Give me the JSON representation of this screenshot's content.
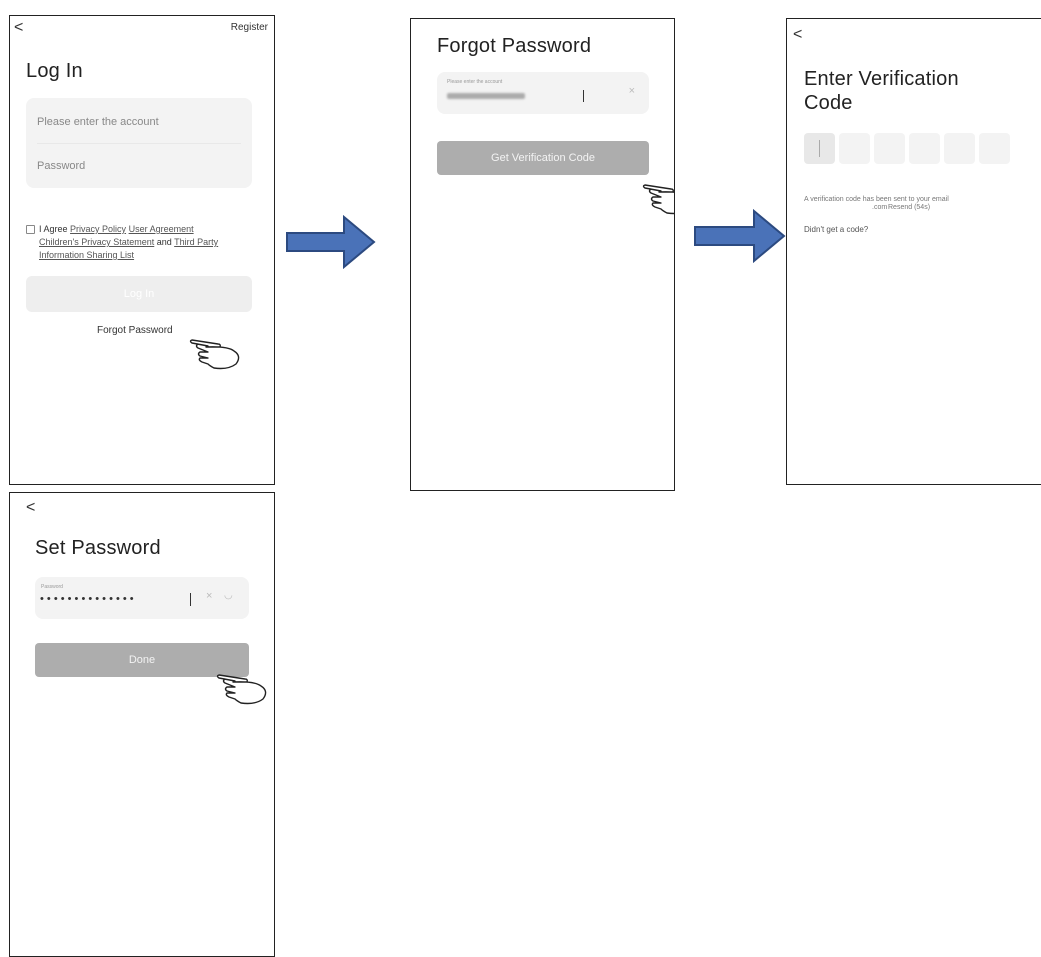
{
  "login": {
    "back": "<",
    "register": "Register",
    "title": "Log In",
    "account_placeholder": "Please enter the account",
    "password_placeholder": "Password",
    "agree": "I Agree",
    "privacy_policy": "Privacy Policy",
    "user_agreement": "User Agreement",
    "children_privacy": "Children's Privacy Statement",
    "and": "and",
    "third_party": "Third Party",
    "info_sharing": "Information Sharing List",
    "login_button": "Log In",
    "forgot_password": "Forgot Password"
  },
  "forgot": {
    "title": "Forgot Password",
    "account_label": "Please enter the account",
    "clear": "×",
    "get_code_button": "Get Verification Code"
  },
  "verify": {
    "back": "<",
    "title_line1": "Enter Verification",
    "title_line2": "Code",
    "sent_text": "A verification code has been sent to your email",
    "email_suffix": ".com",
    "resend": "Resend (54s)",
    "didnt_get": "Didn't get a code?"
  },
  "set_password": {
    "back": "<",
    "title": "Set Password",
    "password_label": "Password",
    "password_value": "• • • • • • • • • • • • • •",
    "clear": "×",
    "eye": "◡",
    "done_button": "Done"
  },
  "colors": {
    "arrow_fill": "#4a72b8",
    "arrow_stroke": "#2c4a80",
    "button_grey": "#adadad",
    "field_bg": "#f3f3f3"
  },
  "icons": [
    "hand-pointer-icon",
    "arrow-right-icon",
    "chevron-left-icon",
    "close-icon",
    "eye-icon",
    "checkbox-icon"
  ]
}
